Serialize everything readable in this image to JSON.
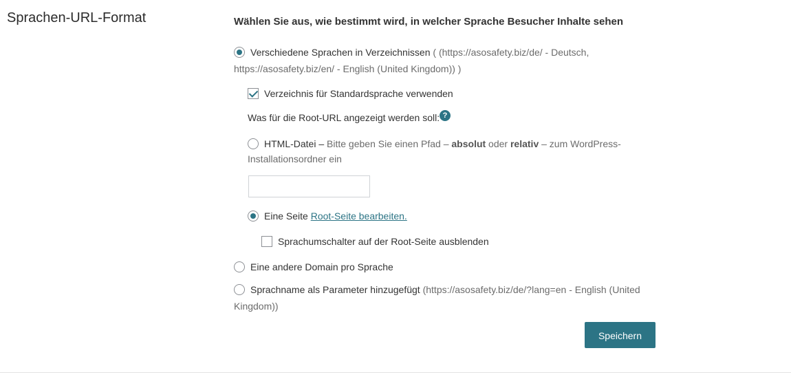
{
  "section": {
    "title": "Sprachen-URL-Format"
  },
  "form": {
    "heading": "Wählen Sie aus, wie bestimmt wird, in welcher Sprache Besucher Inhalte sehen",
    "option_directories": {
      "label": "Verschiedene Sprachen in Verzeichnissen",
      "detail_line1": " ( (https://asosafety.biz/de/ - Deutsch,",
      "detail_line2": "https://asosafety.biz/en/ - English (United Kingdom)) )",
      "selected": true
    },
    "use_default_dir": {
      "label": "Verzeichnis für Standardsprache verwenden",
      "checked": true
    },
    "root_url": {
      "label": "Was für die Root-URL angezeigt werden soll:",
      "help_icon": "?"
    },
    "html_file": {
      "label": "HTML-Datei –",
      "desc_1": " Bitte geben Sie einen Pfad – ",
      "bold_1": "absolut",
      "desc_2": " oder ",
      "bold_2": "relativ",
      "desc_3": " – zum WordPress-",
      "desc_line2": "Installationsordner ein",
      "input_value": "",
      "selected": false
    },
    "page_option": {
      "label": "Eine Seite ",
      "link": "Root-Seite bearbeiten.",
      "selected": true
    },
    "hide_switcher": {
      "label": "Sprachumschalter auf der Root-Seite ausblenden",
      "checked": false
    },
    "option_domain": {
      "label": "Eine andere Domain pro Sprache",
      "selected": false
    },
    "option_param": {
      "label": "Sprachname als Parameter hinzugefügt",
      "detail_line1": " (https://asosafety.biz/de/?lang=en - English (United",
      "detail_line2": "Kingdom))",
      "selected": false
    },
    "save_label": "Speichern"
  },
  "colors": {
    "accent": "#2c7485",
    "text": "#333333",
    "muted": "#6b6b6b"
  }
}
